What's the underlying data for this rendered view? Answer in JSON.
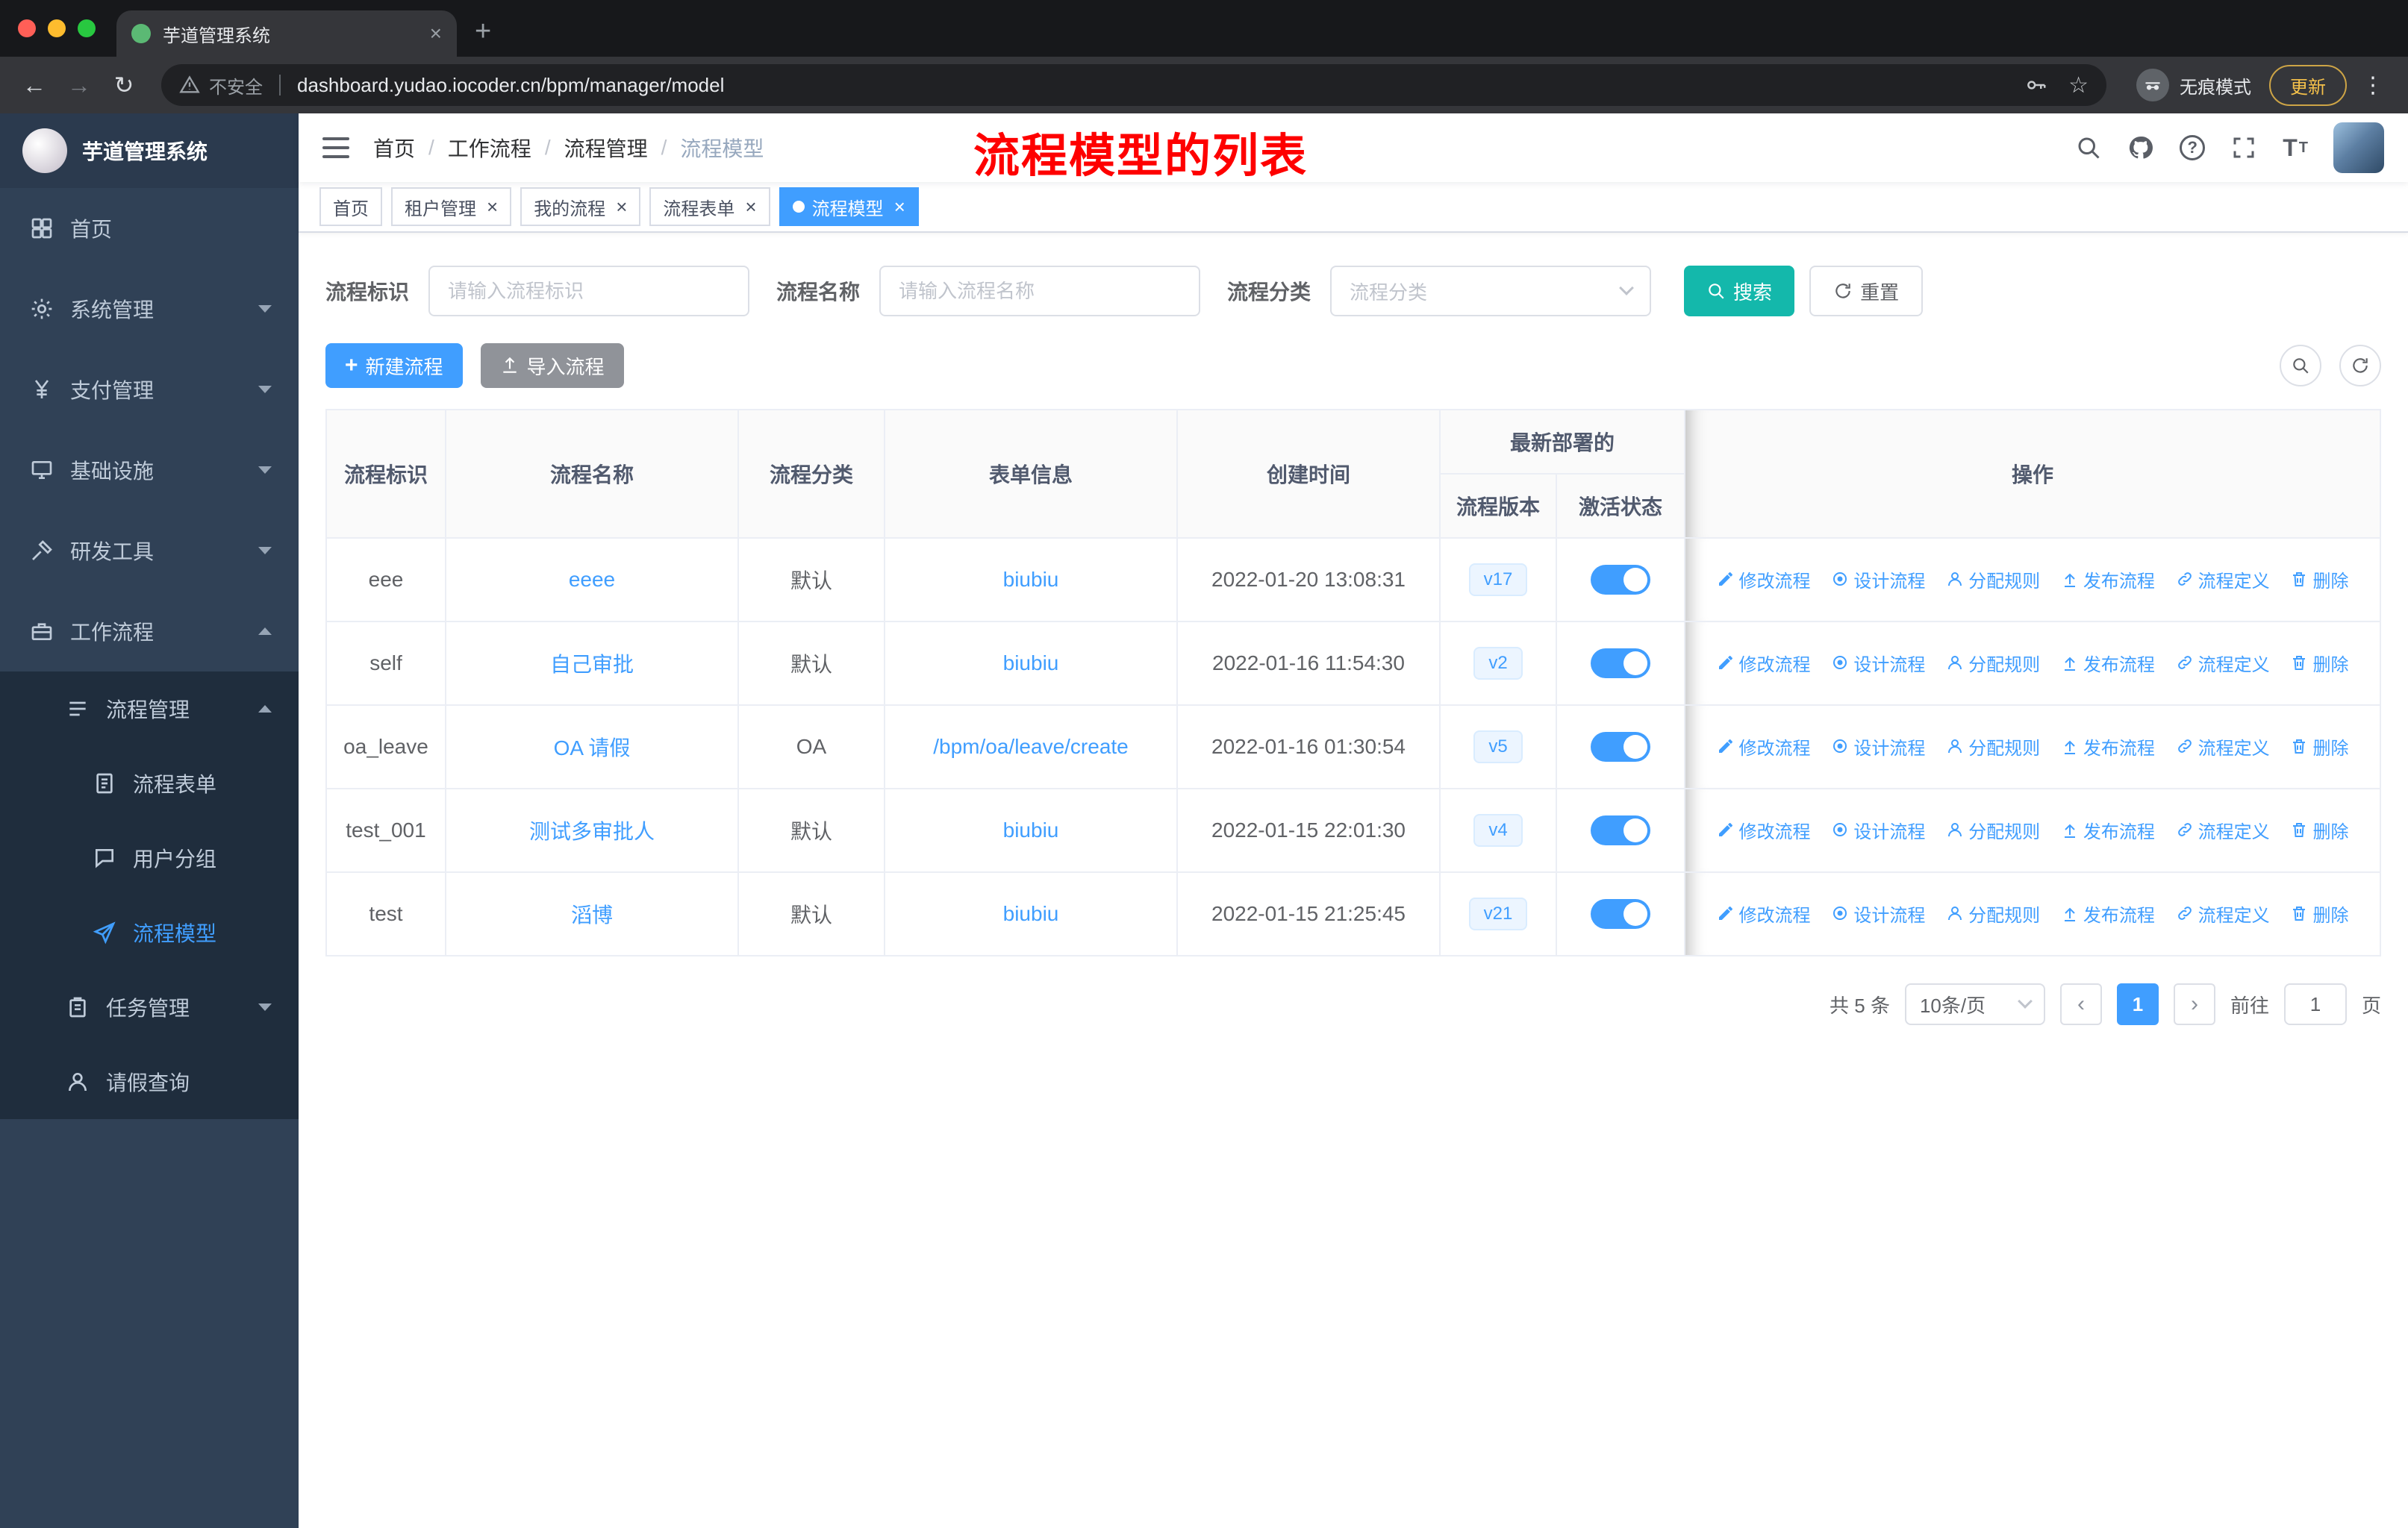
{
  "colors": {
    "primary": "#409eff",
    "search_button": "#14b8ab",
    "annotation_red": "#fe0000",
    "sidebar_bg": "#304156",
    "submenu_bg": "#1f2d3d"
  },
  "browser": {
    "tab_title": "芋道管理系统",
    "security_label": "不安全",
    "url": "dashboard.yudao.iocoder.cn/bpm/manager/model",
    "incognito_label": "无痕模式",
    "update_label": "更新"
  },
  "sidebar": {
    "logo_title": "芋道管理系统",
    "menu": [
      {
        "id": "home",
        "label": "首页",
        "icon": "grid",
        "level": 0
      },
      {
        "id": "system",
        "label": "系统管理",
        "icon": "gear",
        "level": 0,
        "arrow": "down"
      },
      {
        "id": "payment",
        "label": "支付管理",
        "icon": "yen",
        "level": 0,
        "arrow": "down"
      },
      {
        "id": "infra",
        "label": "基础设施",
        "icon": "monitor",
        "level": 0,
        "arrow": "down"
      },
      {
        "id": "devtools",
        "label": "研发工具",
        "icon": "hammer",
        "level": 0,
        "arrow": "down"
      },
      {
        "id": "workflow",
        "label": "工作流程",
        "icon": "case",
        "level": 0,
        "arrow": "up"
      },
      {
        "id": "process-mgmt",
        "label": "流程管理",
        "icon": "bars",
        "level": 1,
        "dark": true,
        "arrow": "up"
      },
      {
        "id": "process-form",
        "label": "流程表单",
        "icon": "doc",
        "level": 2,
        "dark": true
      },
      {
        "id": "user-group",
        "label": "用户分组",
        "icon": "chat",
        "level": 2,
        "dark": true
      },
      {
        "id": "process-model",
        "label": "流程模型",
        "icon": "plane",
        "level": 2,
        "dark": true,
        "active": true
      },
      {
        "id": "task-mgmt",
        "label": "任务管理",
        "icon": "clipboard",
        "level": 1,
        "dark": true,
        "arrow": "down"
      },
      {
        "id": "leave-query",
        "label": "请假查询",
        "icon": "person",
        "level": 1,
        "dark": true
      }
    ]
  },
  "navbar": {
    "breadcrumb": [
      "首页",
      "工作流程",
      "流程管理",
      "流程模型"
    ],
    "annotation": "流程模型的列表"
  },
  "tags": [
    {
      "id": "home",
      "label": "首页",
      "closable": false,
      "active": false
    },
    {
      "id": "tenant",
      "label": "租户管理",
      "closable": true,
      "active": false
    },
    {
      "id": "my-process",
      "label": "我的流程",
      "closable": true,
      "active": false
    },
    {
      "id": "process-form",
      "label": "流程表单",
      "closable": true,
      "active": false
    },
    {
      "id": "process-model",
      "label": "流程模型",
      "closable": true,
      "active": true
    }
  ],
  "filters": {
    "key_label": "流程标识",
    "key_placeholder": "请输入流程标识",
    "name_label": "流程名称",
    "name_placeholder": "请输入流程名称",
    "category_label": "流程分类",
    "category_placeholder": "流程分类",
    "search_label": "搜索",
    "reset_label": "重置"
  },
  "toolbar": {
    "create_label": "新建流程",
    "import_label": "导入流程"
  },
  "table": {
    "columns": {
      "key": "流程标识",
      "name": "流程名称",
      "category": "流程分类",
      "form": "表单信息",
      "created": "创建时间",
      "deploy_group": "最新部署的",
      "version": "流程版本",
      "active": "激活状态",
      "ops": "操作"
    },
    "rows": [
      {
        "key": "eee",
        "name": "eeee",
        "category": "默认",
        "form": "biubiu",
        "created": "2022-01-20 13:08:31",
        "version": "v17",
        "active": true
      },
      {
        "key": "self",
        "name": "自己审批",
        "category": "默认",
        "form": "biubiu",
        "created": "2022-01-16 11:54:30",
        "version": "v2",
        "active": true
      },
      {
        "key": "oa_leave",
        "name": "OA 请假",
        "category": "OA",
        "form": "/bpm/oa/leave/create",
        "created": "2022-01-16 01:30:54",
        "version": "v5",
        "active": true
      },
      {
        "key": "test_001",
        "name": "测试多审批人",
        "category": "默认",
        "form": "biubiu",
        "created": "2022-01-15 22:01:30",
        "version": "v4",
        "active": true
      },
      {
        "key": "test",
        "name": "滔博",
        "category": "默认",
        "form": "biubiu",
        "created": "2022-01-15 21:25:45",
        "version": "v21",
        "active": true
      }
    ],
    "actions": [
      {
        "id": "edit",
        "label": "修改流程",
        "icon": "pencil"
      },
      {
        "id": "design",
        "label": "设计流程",
        "icon": "target"
      },
      {
        "id": "assign",
        "label": "分配规则",
        "icon": "person"
      },
      {
        "id": "publish",
        "label": "发布流程",
        "icon": "publish"
      },
      {
        "id": "definition",
        "label": "流程定义",
        "icon": "link"
      },
      {
        "id": "delete",
        "label": "删除",
        "icon": "trash"
      }
    ]
  },
  "pagination": {
    "total_label": "共 5 条",
    "page_size_label": "10条/页",
    "current_page": "1",
    "goto_label": "前往",
    "goto_value": "1",
    "page_unit_label": "页"
  }
}
